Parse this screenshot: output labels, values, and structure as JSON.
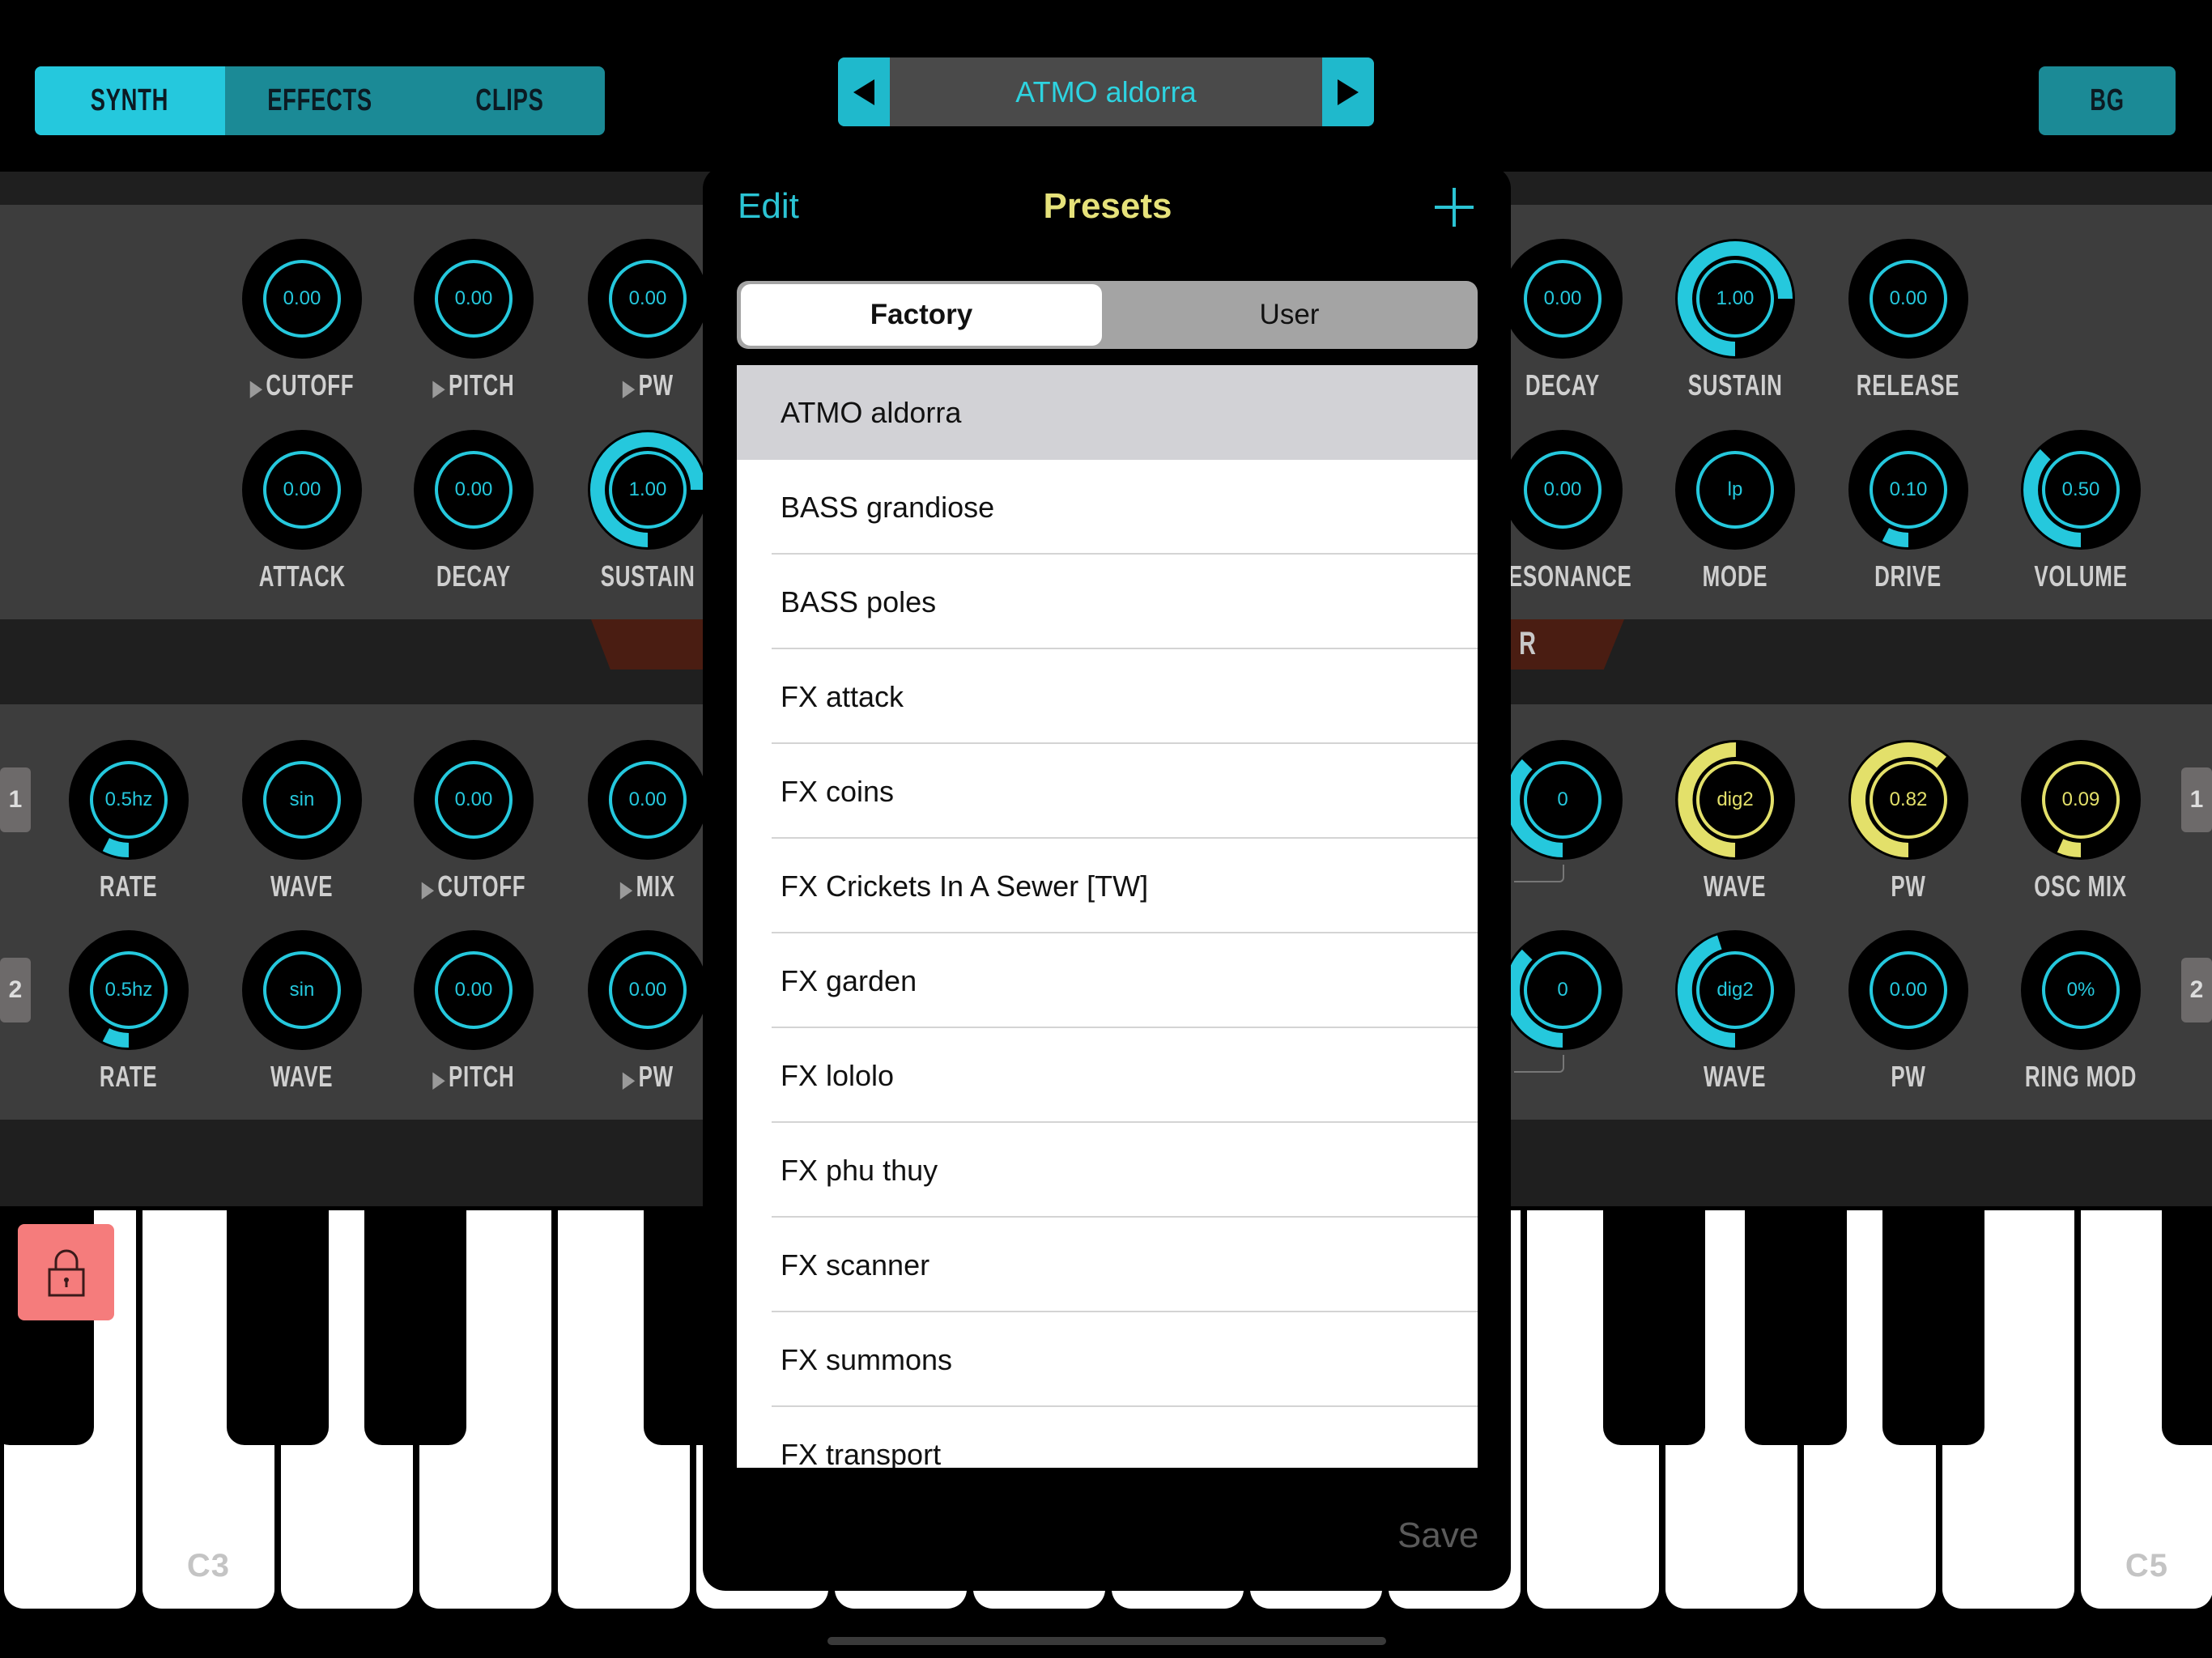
{
  "top_bar": {
    "tabs": [
      {
        "label": "SYNTH",
        "active": true
      },
      {
        "label": "EFFECTS",
        "active": false
      },
      {
        "label": "CLIPS",
        "active": false
      }
    ],
    "preset_selector": {
      "prev_icon": "triangle-left-icon",
      "current": "ATMO aldorra",
      "next_icon": "triangle-right-icon"
    },
    "bg_label": "BG"
  },
  "colors": {
    "accent_cyan": "#25c8dd",
    "accent_yellow": "#e3e06a",
    "tab_inactive": "#1b8a96",
    "knob_bg": "#000000",
    "panel_bg": "#3d3d3d",
    "lock_button": "#f57c7c",
    "section_tag": "#4a1d12"
  },
  "knobs": {
    "upper_left": [
      {
        "value": "0.00",
        "label": "CUTOFF",
        "arrow": true,
        "level": 0,
        "color": "cyan"
      },
      {
        "value": "0.00",
        "label": "PITCH",
        "arrow": true,
        "level": 0,
        "color": "cyan"
      },
      {
        "value": "0.00",
        "label": "PW",
        "arrow": true,
        "level": 0,
        "color": "cyan"
      },
      {
        "value": "0.00",
        "label": "ATTACK",
        "arrow": false,
        "level": 0,
        "color": "cyan"
      },
      {
        "value": "0.00",
        "label": "DECAY",
        "arrow": false,
        "level": 0,
        "color": "cyan"
      },
      {
        "value": "1.00",
        "label": "SUSTAIN",
        "arrow": false,
        "level": 1.0,
        "color": "cyan"
      }
    ],
    "upper_right": [
      {
        "value": "0.00",
        "label": "DECAY",
        "level": 0,
        "color": "cyan"
      },
      {
        "value": "1.00",
        "label": "SUSTAIN",
        "level": 1.0,
        "color": "cyan"
      },
      {
        "value": "0.00",
        "label": "RELEASE",
        "level": 0,
        "color": "cyan"
      },
      {
        "value": "0.00",
        "label": "RESONANCE",
        "level": 0,
        "color": "cyan"
      },
      {
        "value": "lp",
        "label": "MODE",
        "level": 0,
        "color": "cyan"
      },
      {
        "value": "0.10",
        "label": "DRIVE",
        "level": 0.1,
        "color": "cyan"
      },
      {
        "value": "0.50",
        "label": "VOLUME",
        "level": 0.5,
        "color": "cyan"
      }
    ],
    "lfo_left": [
      {
        "row": "1",
        "value": "0.5hz",
        "label": "RATE",
        "arrow": false,
        "level": 0.1,
        "color": "cyan"
      },
      {
        "row": "1",
        "value": "sin",
        "label": "WAVE",
        "arrow": false,
        "level": 0,
        "color": "cyan"
      },
      {
        "row": "1",
        "value": "0.00",
        "label": "CUTOFF",
        "arrow": true,
        "level": 0,
        "color": "cyan"
      },
      {
        "row": "1",
        "value": "0.00",
        "label": "MIX",
        "arrow": true,
        "level": 0,
        "color": "cyan"
      },
      {
        "row": "2",
        "value": "0.5hz",
        "label": "RATE",
        "arrow": false,
        "level": 0.1,
        "color": "cyan"
      },
      {
        "row": "2",
        "value": "sin",
        "label": "WAVE",
        "arrow": false,
        "level": 0,
        "color": "cyan"
      },
      {
        "row": "2",
        "value": "0.00",
        "label": "PITCH",
        "arrow": true,
        "level": 0,
        "color": "cyan"
      },
      {
        "row": "2",
        "value": "0.00",
        "label": "PW",
        "arrow": true,
        "level": 0,
        "color": "cyan"
      }
    ],
    "osc_right": [
      {
        "row": "1",
        "value": "0",
        "label": "",
        "level": 0.5,
        "color": "cyan"
      },
      {
        "row": "1",
        "value": "dig2",
        "label": "WAVE",
        "level": 0.67,
        "color": "yellow"
      },
      {
        "row": "1",
        "value": "0.82",
        "label": "PW",
        "level": 0.82,
        "color": "yellow"
      },
      {
        "row": "1",
        "value": "0.09",
        "label": "OSC MIX",
        "level": 0.09,
        "color": "yellow"
      },
      {
        "row": "2",
        "value": "0",
        "label": "",
        "level": 0.5,
        "color": "cyan"
      },
      {
        "row": "2",
        "value": "dig2",
        "label": "WAVE",
        "level": 0.6,
        "color": "cyan"
      },
      {
        "row": "2",
        "value": "0.00",
        "label": "PW",
        "level": 0,
        "color": "cyan"
      },
      {
        "row": "2",
        "value": "0%",
        "label": "RING MOD",
        "level": 0,
        "color": "cyan"
      }
    ],
    "row_badges_left": [
      "1",
      "2"
    ],
    "row_badges_right": [
      "1",
      "2"
    ],
    "section_tag_right_fragment": "R"
  },
  "keyboard": {
    "lock_icon": "lock-icon",
    "labels": {
      "c3": "C3",
      "c5": "C5"
    }
  },
  "presets_modal": {
    "edit_label": "Edit",
    "title": "Presets",
    "add_icon": "plus-icon",
    "segments": [
      {
        "label": "Factory",
        "active": true
      },
      {
        "label": "User",
        "active": false
      }
    ],
    "items": [
      {
        "name": "ATMO aldorra",
        "selected": true
      },
      {
        "name": "BASS grandiose",
        "selected": false
      },
      {
        "name": "BASS poles",
        "selected": false
      },
      {
        "name": "FX attack",
        "selected": false
      },
      {
        "name": "FX coins",
        "selected": false
      },
      {
        "name": "FX Crickets In A Sewer [TW]",
        "selected": false
      },
      {
        "name": "FX garden",
        "selected": false
      },
      {
        "name": "FX lololo",
        "selected": false
      },
      {
        "name": "FX phu thuy",
        "selected": false
      },
      {
        "name": "FX scanner",
        "selected": false
      },
      {
        "name": "FX summons",
        "selected": false
      },
      {
        "name": "FX transport",
        "selected": false
      }
    ],
    "save_label": "Save"
  }
}
